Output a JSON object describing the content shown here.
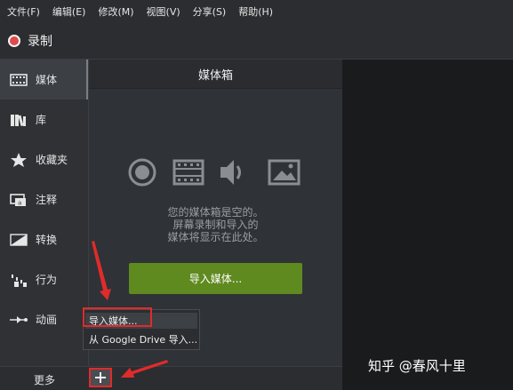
{
  "menubar": {
    "items": [
      "文件(F)",
      "编辑(E)",
      "修改(M)",
      "视图(V)",
      "分享(S)",
      "帮助(H)"
    ]
  },
  "record": {
    "label": "录制"
  },
  "sidebar": {
    "items": [
      {
        "label": "媒体",
        "icon": "film-strip-icon"
      },
      {
        "label": "库",
        "icon": "library-books-icon"
      },
      {
        "label": "收藏夹",
        "icon": "star-icon"
      },
      {
        "label": "注释",
        "icon": "annotation-icon"
      },
      {
        "label": "转换",
        "icon": "transition-icon"
      },
      {
        "label": "行为",
        "icon": "behavior-icon"
      },
      {
        "label": "动画",
        "icon": "animation-icon"
      }
    ],
    "more_label": "更多"
  },
  "bin": {
    "title": "媒体箱",
    "empty_line1": "您的媒体箱是空的。",
    "empty_line2": "屏幕录制和导入的",
    "empty_line3": "媒体将显示在此处。",
    "import_button": "导入媒体..."
  },
  "popup": {
    "items": [
      "导入媒体...",
      "从 Google Drive 导入..."
    ]
  },
  "watermark": "知乎 @春风十里",
  "colors": {
    "accent_green": "#5f8a1f",
    "record_red": "#e04a4a",
    "highlight_red": "#e02b2b"
  }
}
